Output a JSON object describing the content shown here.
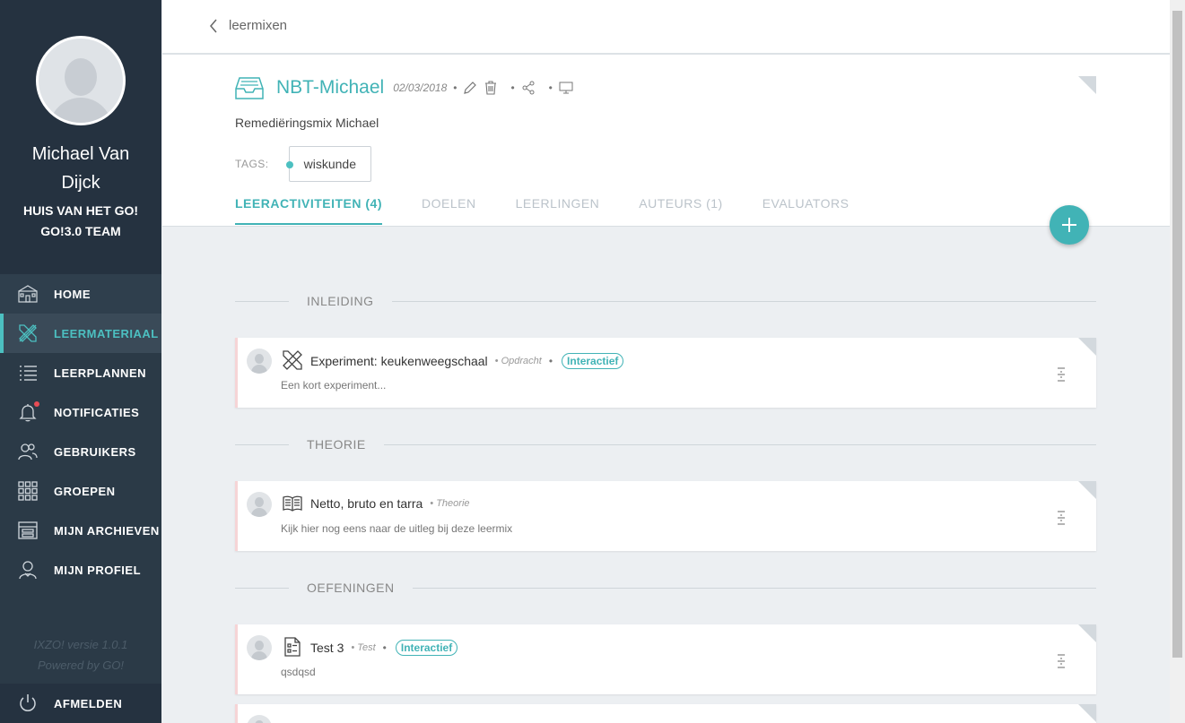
{
  "sidebar": {
    "user_name": "Michael Van Dijck",
    "org_line1": "HUIS VAN HET GO!",
    "org_line2": "GO!3.0 TEAM",
    "items": [
      {
        "label": "HOME",
        "icon": "school-icon"
      },
      {
        "label": "LEERMATERIAAL",
        "icon": "tools-icon",
        "active": true
      },
      {
        "label": "LEERPLANNEN",
        "icon": "list-icon"
      },
      {
        "label": "NOTIFICATIES",
        "icon": "bell-icon"
      },
      {
        "label": "GEBRUIKERS",
        "icon": "users-icon"
      },
      {
        "label": "GROEPEN",
        "icon": "grid-icon"
      },
      {
        "label": "MIJN ARCHIEVEN",
        "icon": "archive-icon"
      },
      {
        "label": "MIJN PROFIEL",
        "icon": "profile-icon"
      }
    ],
    "version": "IXZO! versie 1.0.1",
    "powered": "Powered by GO!",
    "logout": "AFMELDEN"
  },
  "topbar": {
    "back_label": "leermixen"
  },
  "header": {
    "title": "NBT-Michael",
    "date": "02/03/2018",
    "subtitle": "Remediëringsmix Michael",
    "tags_label": "TAGS:",
    "tag": "wiskunde",
    "tabs": [
      "LEERACTIVITEITEN (4)",
      "DOELEN",
      "LEERLINGEN",
      "AUTEURS (1)",
      "EVALUATORS"
    ]
  },
  "sections": [
    {
      "title": "INLEIDING",
      "card": {
        "title": "Experiment: keukenweegschaal",
        "type": "• Opdracht",
        "badge": "Interactief",
        "desc": "Een kort experiment...",
        "icon": "tools-icon"
      }
    },
    {
      "title": "THEORIE",
      "card": {
        "title": "Netto, bruto en tarra",
        "type": "• Theorie",
        "badge": "",
        "desc": "Kijk hier nog eens naar de uitleg bij deze leermix",
        "icon": "book-icon"
      }
    },
    {
      "title": "OEFENINGEN",
      "card": {
        "title": "Test 3",
        "type": "• Test",
        "badge": "Interactief",
        "desc": "qsdqsd",
        "icon": "test-icon"
      }
    }
  ],
  "colors": {
    "accent": "#41b3b6",
    "sidebar": "#2b3a47",
    "notification": "#e84c55"
  }
}
